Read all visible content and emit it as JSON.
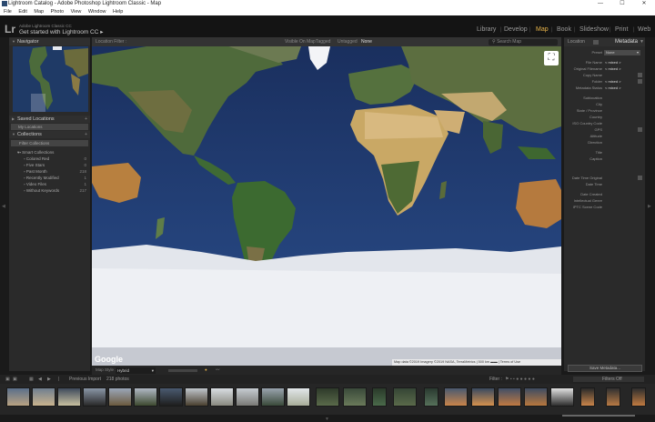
{
  "window": {
    "title": "Lightroom Catalog - Adobe Photoshop Lightroom Classic - Map",
    "controls": [
      "—",
      "☐",
      "✕"
    ]
  },
  "menu": [
    "File",
    "Edit",
    "Map",
    "Photo",
    "View",
    "Window",
    "Help"
  ],
  "identity": {
    "logo": "Lr",
    "top_text": "Adobe Lightroom Classic CC",
    "main_text": "Get started with Lightroom CC ▸"
  },
  "modules": [
    {
      "label": "Library",
      "active": false
    },
    {
      "label": "Develop",
      "active": false
    },
    {
      "label": "Map",
      "active": true
    },
    {
      "label": "Book",
      "active": false
    },
    {
      "label": "Slideshow",
      "active": false
    },
    {
      "label": "Print",
      "active": false
    },
    {
      "label": "Web",
      "active": false
    }
  ],
  "left_panel": {
    "navigator": "Navigator",
    "saved_locations": "Saved Locations",
    "my_locations": "My Locations",
    "collections": "Collections",
    "filter_collections": "Filter Collections",
    "smart_collections": "Smart Collections",
    "items": [
      {
        "label": "Colored Red",
        "count": "0"
      },
      {
        "label": "Five Stars",
        "count": "0"
      },
      {
        "label": "Past Month",
        "count": "218"
      },
      {
        "label": "Recently Modified",
        "count": "1"
      },
      {
        "label": "Video Files",
        "count": "1"
      },
      {
        "label": "Without Keywords",
        "count": "217"
      }
    ]
  },
  "filter_bar": {
    "title": "Location Filter :",
    "options": [
      "Visible On Map",
      "Tagged",
      "Untagged",
      "None"
    ],
    "search": "Search Map"
  },
  "map": {
    "google": "Google",
    "attribution": "Map data ©2019 Imagery ©2019 NASA, TerraMetrics",
    "scale": "500 km",
    "terms": "Terms of Use",
    "expand_icon": "fullscreen-icon"
  },
  "map_toolbar": {
    "style_label": "Map Style :",
    "style_value": "Hybrid"
  },
  "right_panel": {
    "location_label": "Location",
    "metadata_label": "Metadata",
    "preset_label": "Preset",
    "preset_value": "None",
    "fields": [
      {
        "label": "File Name",
        "value": "< mixed >"
      },
      {
        "label": "Original Filename",
        "value": "< mixed >"
      },
      {
        "label": "Copy Name",
        "value": ""
      },
      {
        "label": "Folder",
        "value": "< mixed >"
      },
      {
        "label": "Metadata Status",
        "value": "< mixed >"
      },
      {
        "label": "",
        "value": ""
      },
      {
        "label": "Sublocation",
        "value": ""
      },
      {
        "label": "City",
        "value": ""
      },
      {
        "label": "State / Province",
        "value": ""
      },
      {
        "label": "Country",
        "value": ""
      },
      {
        "label": "ISO Country Code",
        "value": ""
      },
      {
        "label": "GPS",
        "value": ""
      },
      {
        "label": "Altitude",
        "value": ""
      },
      {
        "label": "Direction",
        "value": ""
      },
      {
        "label": "",
        "value": ""
      },
      {
        "label": "Title",
        "value": ""
      },
      {
        "label": "Caption",
        "value": ""
      },
      {
        "label": "",
        "value": ""
      },
      {
        "label": "",
        "value": ""
      },
      {
        "label": "Date Time Original",
        "value": ""
      },
      {
        "label": "Date Time",
        "value": ""
      },
      {
        "label": "",
        "value": ""
      },
      {
        "label": "Date Created",
        "value": ""
      },
      {
        "label": "Intellectual Genre",
        "value": ""
      },
      {
        "label": "IPTC Scene Code",
        "value": ""
      }
    ],
    "save_button": "Save Metadata..."
  },
  "filmstrip": {
    "source": "Previous Import",
    "count": "218 photos",
    "filter_label": "Filter :",
    "filters_off": "Filters Off"
  },
  "colors": {
    "accent": "#e8b44a",
    "ocean": "#1c3466",
    "land": "#4b6b3a",
    "ice": "#e6e9ef"
  }
}
